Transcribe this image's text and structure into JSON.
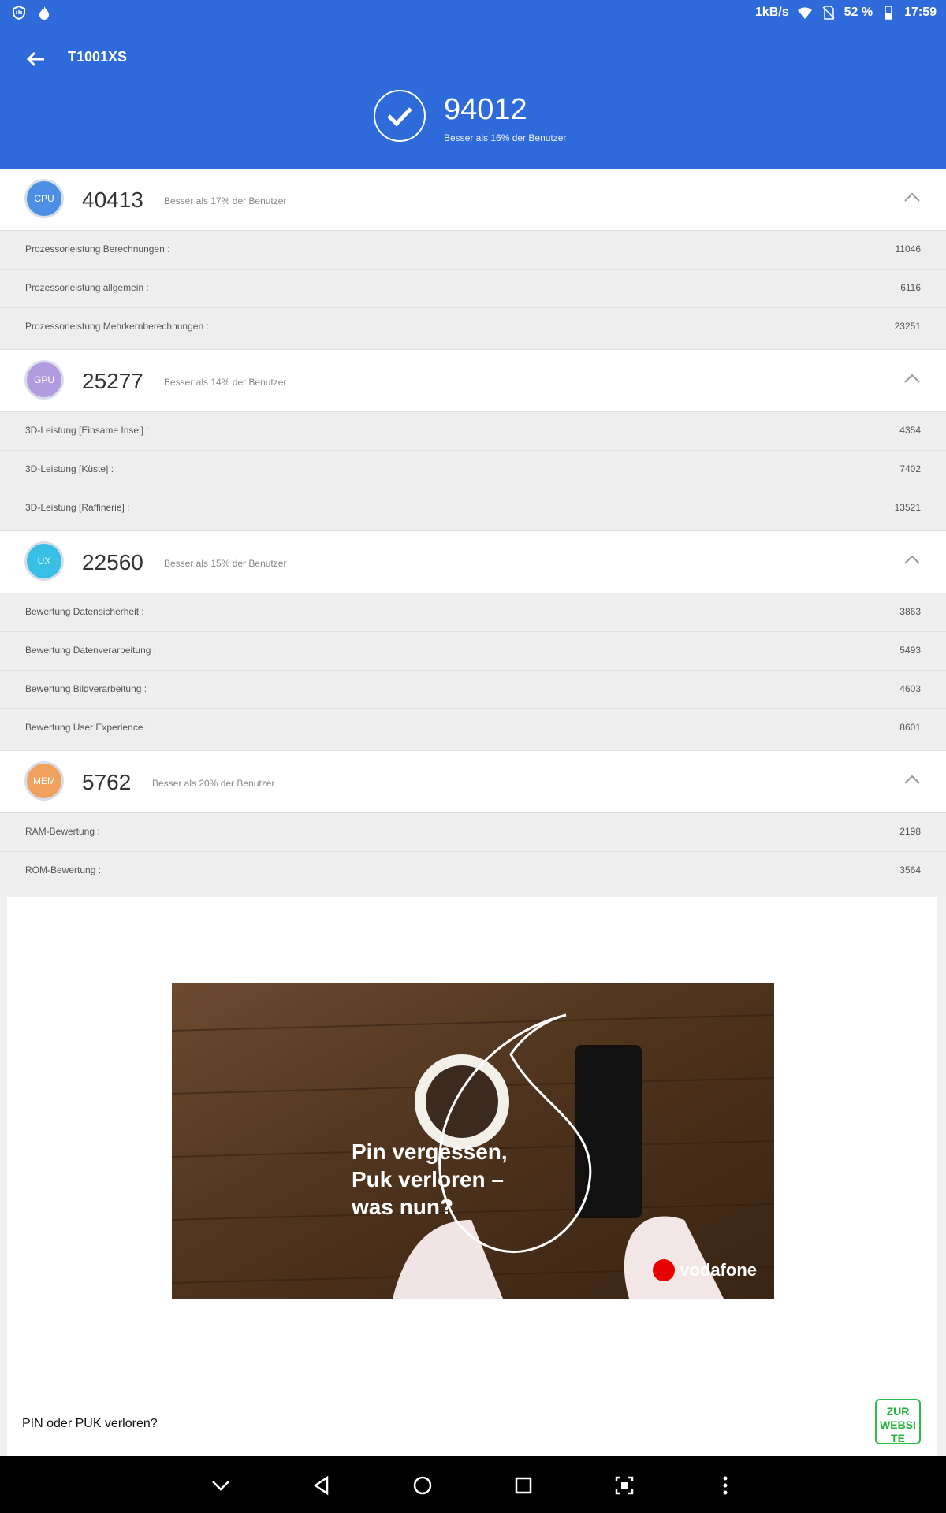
{
  "status_bar": {
    "net_speed": "1kB/s",
    "battery": "52 %",
    "time": "17:59",
    "icons": [
      "shield-hand-icon",
      "fire-icon",
      "wifi-icon",
      "no-sim-icon",
      "battery-icon"
    ]
  },
  "header": {
    "device_name": "T1001XS",
    "total_score": "94012",
    "total_subtitle": "Besser als 16% der Benutzer"
  },
  "sections": [
    {
      "badge": "CPU",
      "badge_color": "#4e8fe6",
      "score": "40413",
      "subtitle": "Besser als 17% der Benutzer",
      "rows": [
        {
          "label": "Prozessorleistung Berechnungen :",
          "value": "11046"
        },
        {
          "label": "Prozessorleistung allgemein :",
          "value": "6116"
        },
        {
          "label": "Prozessorleistung Mehrkernberechnungen :",
          "value": "23251"
        }
      ]
    },
    {
      "badge": "GPU",
      "badge_color": "#b39be0",
      "score": "25277",
      "subtitle": "Besser als 14% der Benutzer",
      "rows": [
        {
          "label": "3D-Leistung [Einsame Insel] :",
          "value": "4354"
        },
        {
          "label": "3D-Leistung [Küste] :",
          "value": "7402"
        },
        {
          "label": "3D-Leistung [Raffinerie] :",
          "value": "13521"
        }
      ]
    },
    {
      "badge": "UX",
      "badge_color": "#38bfe6",
      "score": "22560",
      "subtitle": "Besser als 15% der Benutzer",
      "rows": [
        {
          "label": "Bewertung Datensicherheit :",
          "value": "3863"
        },
        {
          "label": "Bewertung Datenverarbeitung :",
          "value": "5493"
        },
        {
          "label": "Bewertung Bildverarbeitung :",
          "value": "4603"
        },
        {
          "label": "Bewertung User Experience :",
          "value": "8601"
        }
      ]
    },
    {
      "badge": "MEM",
      "badge_color": "#f0a15e",
      "score": "5762",
      "subtitle": "Besser als 20% der Benutzer",
      "rows": [
        {
          "label": "RAM-Bewertung :",
          "value": "2198"
        },
        {
          "label": "ROM-Bewertung :",
          "value": "3564"
        }
      ]
    }
  ],
  "ad": {
    "headline": "Pin vergessen,\nPuk verloren –\nwas nun?",
    "brand": "vodafone",
    "caption": "PIN oder PUK verloren?",
    "button": "ZUR WEBSI TE"
  },
  "nav": [
    "chevron-down-icon",
    "back-triangle-icon",
    "home-circle-icon",
    "recents-square-icon",
    "screenshot-icon",
    "more-vert-icon"
  ]
}
